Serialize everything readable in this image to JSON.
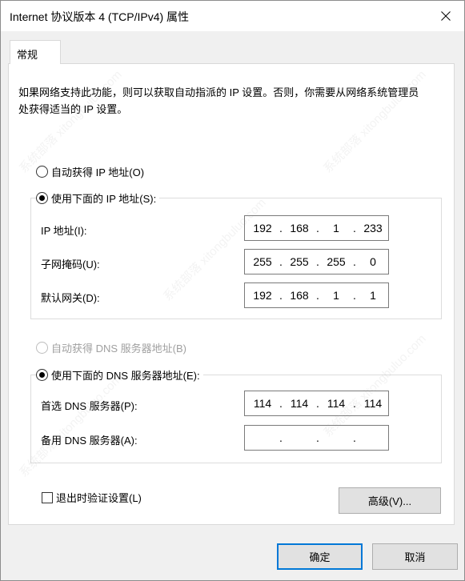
{
  "window": {
    "title": "Internet 协议版本 4 (TCP/IPv4) 属性"
  },
  "tabs": [
    {
      "label": "常规"
    }
  ],
  "description": "如果网络支持此功能，则可以获取自动指派的 IP 设置。否则，你需要从网络系统管理员处获得适当的 IP 设置。",
  "ip_section": {
    "auto_label": "自动获得 IP 地址(O)",
    "manual_label": "使用下面的 IP 地址(S):",
    "fields": [
      {
        "label": "IP 地址(I):",
        "octets": [
          "192",
          "168",
          "1",
          "233"
        ]
      },
      {
        "label": "子网掩码(U):",
        "octets": [
          "255",
          "255",
          "255",
          "0"
        ]
      },
      {
        "label": "默认网关(D):",
        "octets": [
          "192",
          "168",
          "1",
          "1"
        ]
      }
    ]
  },
  "dns_section": {
    "auto_label": "自动获得 DNS 服务器地址(B)",
    "manual_label": "使用下面的 DNS 服务器地址(E):",
    "fields": [
      {
        "label": "首选 DNS 服务器(P):",
        "octets": [
          "114",
          "114",
          "114",
          "114"
        ]
      },
      {
        "label": "备用 DNS 服务器(A):",
        "octets": [
          "",
          "",
          "",
          ""
        ]
      }
    ]
  },
  "validate_on_exit_label": "退出时验证设置(L)",
  "advanced_button": "高级(V)...",
  "ok_button": "确定",
  "cancel_button": "取消",
  "watermark_text": "系统部落 xitongbuluo.com"
}
